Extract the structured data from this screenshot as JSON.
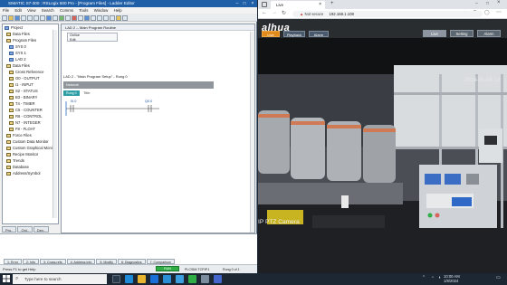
{
  "left_window": {
    "title": "SIMATIC S7-300 : RSLogix 500 Pro - [Program Files] - Ladder Editor",
    "menu": [
      "File",
      "Edit",
      "View",
      "Search",
      "Comms",
      "Tools",
      "Window",
      "Help"
    ],
    "tree_items": [
      "Project",
      "Data Files",
      "Program Files",
      "SYS 0",
      "SYS 1",
      "LAD 2",
      "Data Files",
      "Cross Reference",
      "O0 - OUTPUT",
      "I1 - INPUT",
      "S2 - STATUS",
      "B3 - BINARY",
      "T4 - TIMER",
      "C5 - COUNTER",
      "R6 - CONTROL",
      "N7 - INTEGER",
      "F8 - FLOAT",
      "Force Files",
      "Custom Data Monitor",
      "Custom Graphical Monitor",
      "Recipe Monitor",
      "Trends",
      "Database",
      "Address/Symbol"
    ],
    "tree_tabs": [
      "Pro..",
      "Onl..",
      "Dev.."
    ],
    "main_title": "LAD 2 -- Main Program Routine",
    "props_line1": "Online",
    "props_line2": "Edit",
    "rung_heading": "LAD 2 - \"Main Program Setup\" - Rung 0",
    "rung_label": "Network",
    "rung_chip": "Rung 0",
    "rung_comment": "Title:",
    "contact_left": "I0.0",
    "contact_right": "Q0.0",
    "bottom_tabs": [
      "1: Error",
      "2: Info",
      "3: Cross-refs",
      "4: Address info",
      "5: Modify",
      "6: Diagnostics",
      "7: Comparison"
    ],
    "status_text": "Press F1 to get Help",
    "status_mode": "RUN",
    "status_address": "PLCSIM.TCPIP.1",
    "status_rung": "Rung 0 of 1"
  },
  "browser": {
    "tab_title": "Live",
    "url_security": "Not secure",
    "url": "192.168.1.108",
    "brand": "alhua",
    "header_buttons": [
      "Live",
      "Playback",
      "Alarm"
    ],
    "right_buttons": [
      "Live",
      "Setting",
      "Alarm"
    ],
    "camera_timestamp": "2024-01-08 10:",
    "camera_name": "IP PTZ Camera"
  },
  "taskbar": {
    "search_placeholder": "Type here to search",
    "tray_time": "10:00 AM",
    "tray_date": "1/8/2024"
  },
  "colors": {
    "title_bar": "#1f5fa8",
    "status_run": "#2fae45",
    "taskbar": "#1c2733"
  }
}
